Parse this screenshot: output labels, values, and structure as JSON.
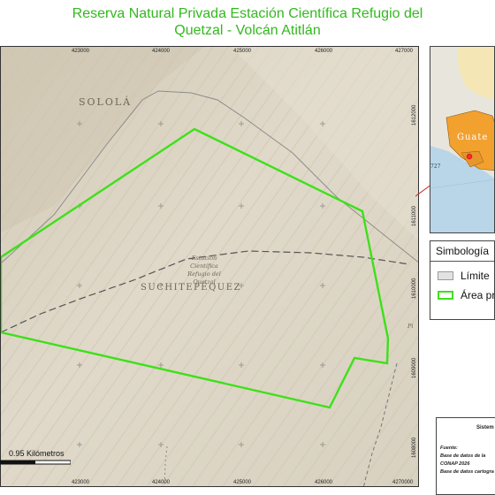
{
  "title": {
    "line1": "Reserva Natural Privada Estación Científica Refugio del",
    "line2": "Quetzal - Volcán Atitlán"
  },
  "map": {
    "labels": {
      "solola": "SOLOLÁ",
      "suchitepequez": "SUCHITEPÉQUEZ",
      "station_1": "Estación",
      "station_2": "Científica",
      "station_3": "Refugio del",
      "station_4": "Quetzal",
      "side_fragment": "Pi"
    },
    "x_ticks_top": [
      "423000",
      "424000",
      "425000",
      "426000",
      "427000"
    ],
    "x_ticks_bottom": [
      "423000",
      "424000",
      "425000",
      "426000",
      "4270000"
    ],
    "y_ticks_right": [
      "1612000",
      "1611000",
      "1610000",
      "1609000",
      "1608000"
    ],
    "colors": {
      "area_outline": "#3ee01a",
      "limit_line": "#8c8c8c",
      "dept_boundary": "#555555",
      "terrain": "#ddd6c6"
    }
  },
  "inset": {
    "label": "Guate",
    "side_number": "727"
  },
  "legend": {
    "title": "Simbología",
    "items": [
      {
        "label": "Límite",
        "swatch": "limit"
      },
      {
        "label": "Área pr",
        "swatch": "area"
      }
    ]
  },
  "info": {
    "heading": "Sistem",
    "source_label": "Fuente:",
    "source_line1": "Base de datos de la",
    "source_line2": "CONAP 2026",
    "source_line3": "Base de datos cartogra"
  },
  "scale": {
    "label": "0.95 Kilómetros"
  }
}
